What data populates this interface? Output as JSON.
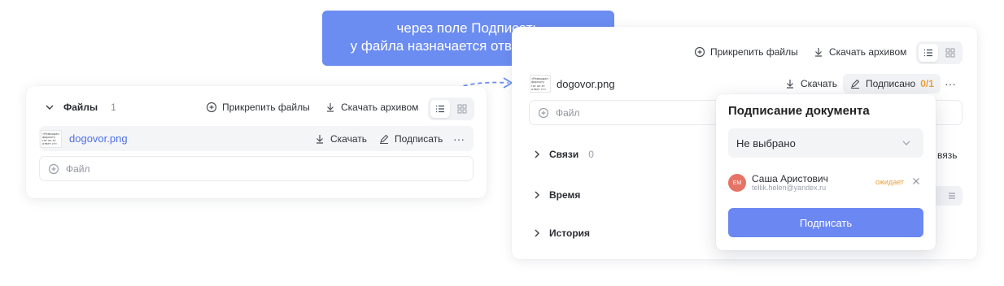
{
  "callout": {
    "line1": "через поле Подписать",
    "line2": "у файла назначается ответственный",
    "color": "#6b8cf0"
  },
  "left_panel": {
    "files_title": "Файлы",
    "files_count": "1",
    "attach_label": "Прикрепить файлы",
    "download_archive_label": "Скачать архивом",
    "file": {
      "thumb_text": "«Рамордан форкату гог ок ет ответ ст»",
      "name": "dogovor.png",
      "download_label": "Скачать",
      "sign_label": "Подписать",
      "more": "···"
    },
    "file_field_placeholder": "Файл"
  },
  "right_panel": {
    "attach_label": "Прикрепить файлы",
    "download_archive_label": "Скачать архивом",
    "file": {
      "thumb_text": "«Рамордан форкату гог ок ет ответ ст»",
      "name": "dogovor.png",
      "download_label": "Скачать",
      "signed_label": "Подписано",
      "signed_count": "0/1",
      "more": "···"
    },
    "file_field_placeholder": "Файл",
    "sections": [
      {
        "title": "Связи",
        "count": "0"
      },
      {
        "title": "Время",
        "count": ""
      },
      {
        "title": "История",
        "count": ""
      }
    ],
    "partial_right_text": "вязь"
  },
  "popover": {
    "title": "Подписание документа",
    "select_value": "Не выбрано",
    "signer": {
      "initials": "ЕМ",
      "name": "Саша Аристович",
      "email": "tellik.helen@yandex.ru",
      "status": "ожидает",
      "status_color": "#e9a03b"
    },
    "sign_button_label": "Подписать",
    "button_color": "#6b87f2"
  }
}
